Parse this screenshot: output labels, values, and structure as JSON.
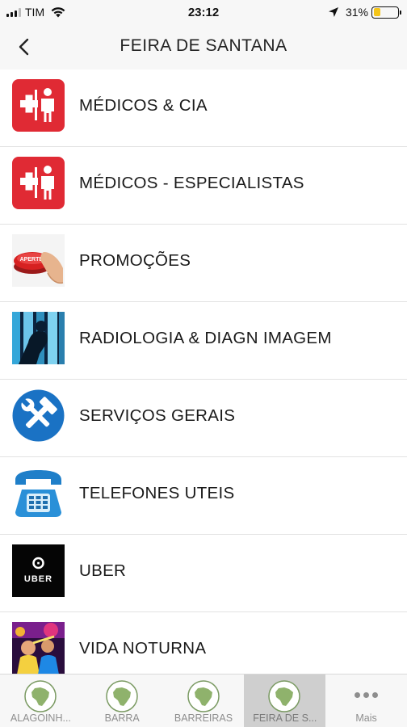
{
  "status_bar": {
    "carrier": "TIM",
    "time": "23:12",
    "battery_percent": "31%",
    "battery_level": 0.31
  },
  "nav": {
    "title": "FEIRA DE SANTANA",
    "back_icon": "chevron-left-icon"
  },
  "list": {
    "items": [
      {
        "label": "MÉDICOS & CIA",
        "icon": "medical-icon"
      },
      {
        "label": "MÉDICOS - ESPECIALISTAS",
        "icon": "medical-icon"
      },
      {
        "label": "PROMOÇÕES",
        "icon": "promo-button-icon",
        "icon_text": "APERTE!"
      },
      {
        "label": "RADIOLOGIA & DIAGN IMAGEM",
        "icon": "xray-icon"
      },
      {
        "label": "SERVIÇOS GERAIS",
        "icon": "tools-icon"
      },
      {
        "label": "TELEFONES UTEIS",
        "icon": "telephone-icon"
      },
      {
        "label": "UBER",
        "icon": "uber-logo-icon",
        "icon_text": "UBER"
      },
      {
        "label": "VIDA NOTURNA",
        "icon": "nightlife-icon"
      }
    ]
  },
  "tab_bar": {
    "tabs": [
      {
        "label": "ALAGOINH...",
        "icon": "brazil-map-icon",
        "active": false
      },
      {
        "label": "BARRA",
        "icon": "brazil-map-icon",
        "active": false
      },
      {
        "label": "BARREIRAS",
        "icon": "brazil-map-icon",
        "active": false
      },
      {
        "label": "FEIRA DE S...",
        "icon": "brazil-map-icon",
        "active": true
      },
      {
        "label": "Mais",
        "icon": "more-dots-icon",
        "active": false
      }
    ]
  },
  "colors": {
    "medical_red": "#e02a34",
    "tools_blue": "#1a72c4",
    "battery_yellow": "#f5c518",
    "active_tab_bg": "#cfcfcf"
  }
}
